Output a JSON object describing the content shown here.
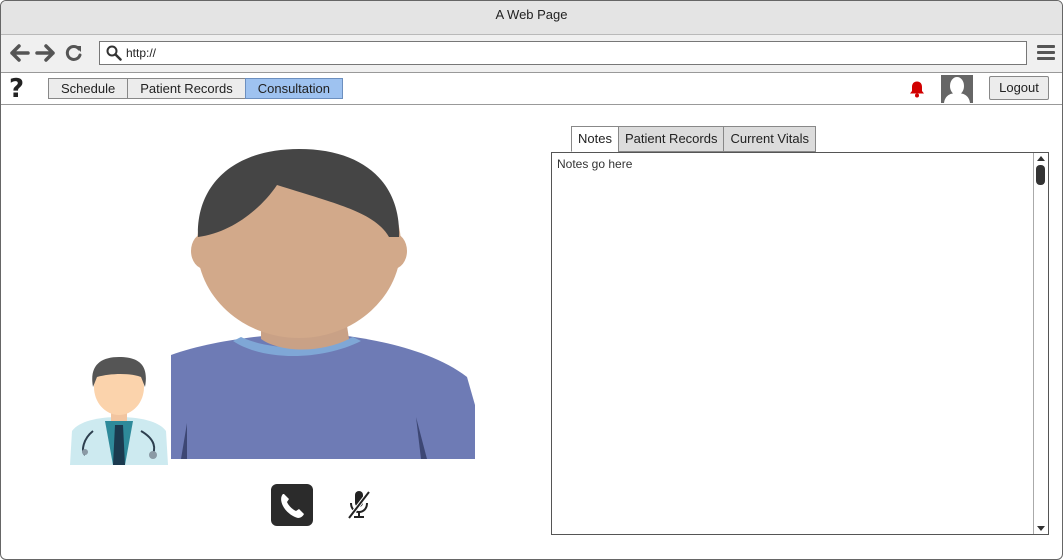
{
  "window": {
    "title": "A Web Page"
  },
  "browser": {
    "url": "http://"
  },
  "appbar": {
    "help_icon": "?",
    "tabs": [
      {
        "label": "Schedule",
        "active": false
      },
      {
        "label": "Patient Records",
        "active": false
      },
      {
        "label": "Consultation",
        "active": true
      }
    ],
    "logout_label": "Logout"
  },
  "panel": {
    "tabs": [
      {
        "label": "Notes",
        "active": true
      },
      {
        "label": "Patient Records",
        "active": false
      },
      {
        "label": "Current Vitals",
        "active": false
      }
    ],
    "notes_text": "Notes go here"
  },
  "colors": {
    "active_tab": "#9ec2f0",
    "bell": "#d10000",
    "patient_shirt": "#6e7bb5",
    "patient_skin": "#d2a98a"
  },
  "icons": {
    "back": "arrow-left-icon",
    "forward": "arrow-right-icon",
    "reload": "reload-icon",
    "search": "search-icon",
    "menu": "hamburger-icon",
    "bell": "bell-icon",
    "call": "phone-icon",
    "mic": "mic-off-icon"
  }
}
